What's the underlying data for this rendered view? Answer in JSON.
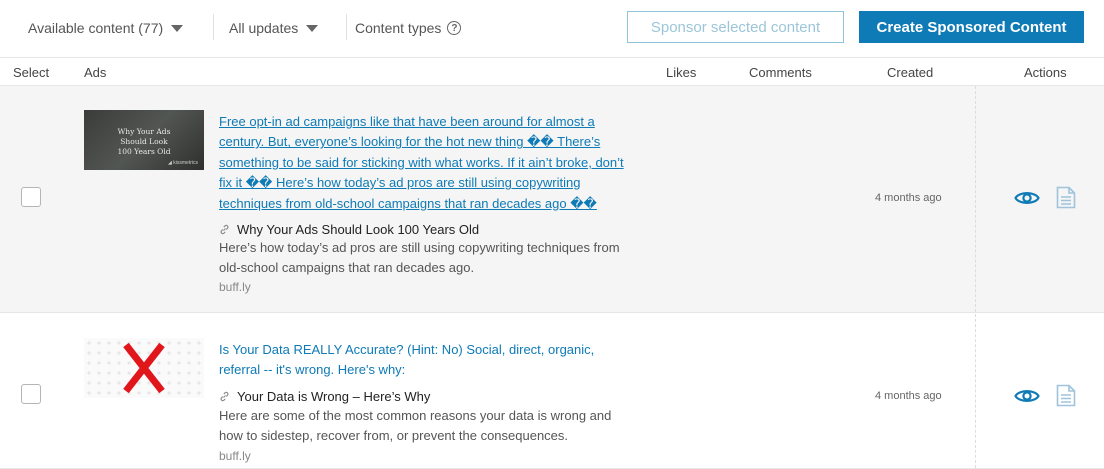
{
  "toolbar": {
    "available_filter": "Available content (77)",
    "updates_filter": "All updates",
    "content_types": "Content types",
    "sponsor_selected_label": "Sponsor selected content",
    "create_sponsored_label": "Create Sponsored Content"
  },
  "table": {
    "columns": [
      "Select",
      "Ads",
      "Likes",
      "Comments",
      "Created",
      "Actions"
    ]
  },
  "rows": [
    {
      "thumbnail_text": "Why Your Ads Should Look 100 Years Old",
      "thumbnail_brand": "◢ kissmetrics",
      "post_text": "Free opt-in ad campaigns like that have been around for almost a century. But, everyone’s looking for the hot new thing �� There’s something to be said for sticking with what works. If it ain’t broke, don’t fix it �� Here’s how today’s ad pros are still using copywriting techniques from old-school campaigns that ran decades ago ��",
      "link_title": "Why Your Ads Should Look 100 Years Old",
      "link_description": "Here’s how today’s ad pros are still using copywriting techniques from old-school campaigns that ran decades ago.",
      "domain": "buff.ly",
      "created": "4 months ago"
    },
    {
      "post_text": "Is Your Data REALLY Accurate? (Hint: No) Social, direct, organic, referral -- it's wrong. Here's why:",
      "link_title": "Your Data is Wrong – Here’s Why",
      "link_description": "Here are some of the most common reasons your data is wrong and how to sidestep, recover from, or prevent the consequences.",
      "domain": "buff.ly",
      "created": "4 months ago"
    }
  ],
  "colors": {
    "accent": "#0e7ab6",
    "thumbnail_x": "#e0161b"
  },
  "icons": [
    "chevron-down-icon",
    "help-icon",
    "link-icon",
    "eye-icon",
    "document-icon",
    "x-mark-icon"
  ]
}
